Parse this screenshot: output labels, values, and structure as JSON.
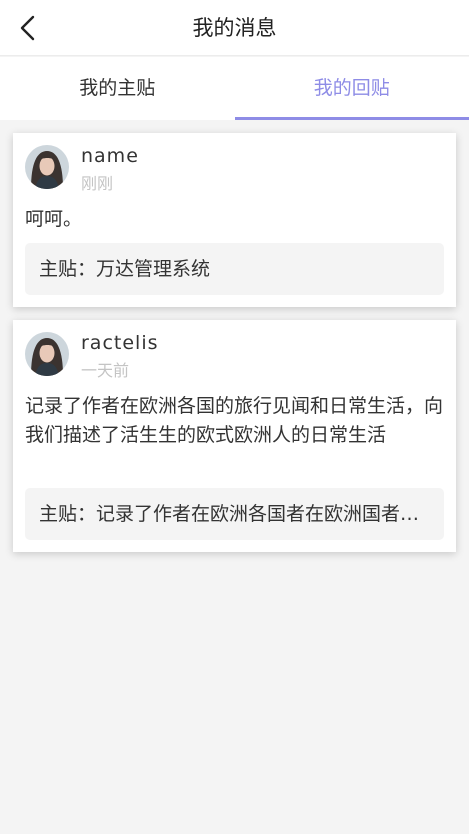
{
  "header": {
    "title": "我的消息",
    "back_icon": "chevron-left-icon"
  },
  "tabs": [
    {
      "label": "我的主贴",
      "active": false
    },
    {
      "label": "我的回贴",
      "active": true
    }
  ],
  "accent_color": "#8e8ce6",
  "replies": [
    {
      "username": "name",
      "time": "刚刚",
      "content": "呵呵。",
      "main_post": "主贴：万达管理系统"
    },
    {
      "username": "ractelis",
      "time": "一天前",
      "content": "记录了作者在欧洲各国的旅行见闻和日常生活，向我们描述了活生生的欧式欧洲人的日常生活",
      "main_post": "主贴：记录了作者在欧洲各国者在欧洲国者在欧洲"
    }
  ]
}
